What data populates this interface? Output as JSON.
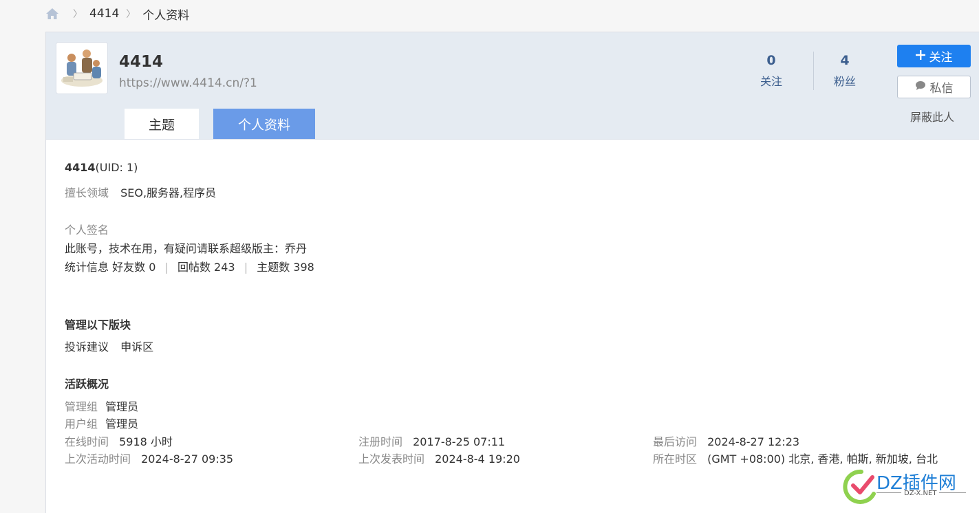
{
  "breadcrumb": {
    "icon": "home-icon",
    "items": [
      "4414",
      "个人资料"
    ]
  },
  "profile": {
    "name": "4414",
    "url": "https://www.4414.cn/?1",
    "avatar_icon": "avatar-illustration",
    "stats": {
      "following_count": "0",
      "following_label": "关注",
      "fans_count": "4",
      "fans_label": "粉丝"
    },
    "buttons": {
      "follow": "关注",
      "message": "私信",
      "block": "屏蔽此人"
    },
    "tabs": [
      "主题",
      "个人资料"
    ],
    "active_tab": "个人资料"
  },
  "details": {
    "uid_name": "4414",
    "uid_text": "(UID: 1)",
    "expertise_label": "擅长领域",
    "expertise_value": "SEO,服务器,程序员",
    "signature_label": "个人签名",
    "signature_value": "此账号，技术在用，有疑问请联系超级版主：乔丹",
    "stats_label": "统计信息",
    "friends": "好友数 0",
    "replies": "回帖数 243",
    "topics": "主题数 398",
    "manage_heading": "管理以下版块",
    "manage_boards": [
      "投诉建议",
      "申诉区"
    ],
    "activity_heading": "活跃概况",
    "admin_group_label": "管理组",
    "admin_group_value": "管理员",
    "user_group_label": "用户组",
    "user_group_value": "管理员",
    "online_label": "在线时间",
    "online_value": "5918 小时",
    "register_label": "注册时间",
    "register_value": "2017-8-25 07:11",
    "lastvisit_label": "最后访问",
    "lastvisit_value": "2024-8-27 12:23",
    "lastactive_label": "上次活动时间",
    "lastactive_value": "2024-8-27 09:35",
    "lastpost_label": "上次发表时间",
    "lastpost_value": "2024-8-4 19:20",
    "timezone_label": "所在时区",
    "timezone_value": "(GMT +08:00) 北京, 香港, 帕斯, 新加坡, 台北"
  },
  "watermark": {
    "brand": "DZ插件网",
    "sub": "DZ-X.NET"
  },
  "colors": {
    "accent": "#1e80f0",
    "tab_active": "#6a9be8",
    "header_bg": "#e5ebf2"
  }
}
